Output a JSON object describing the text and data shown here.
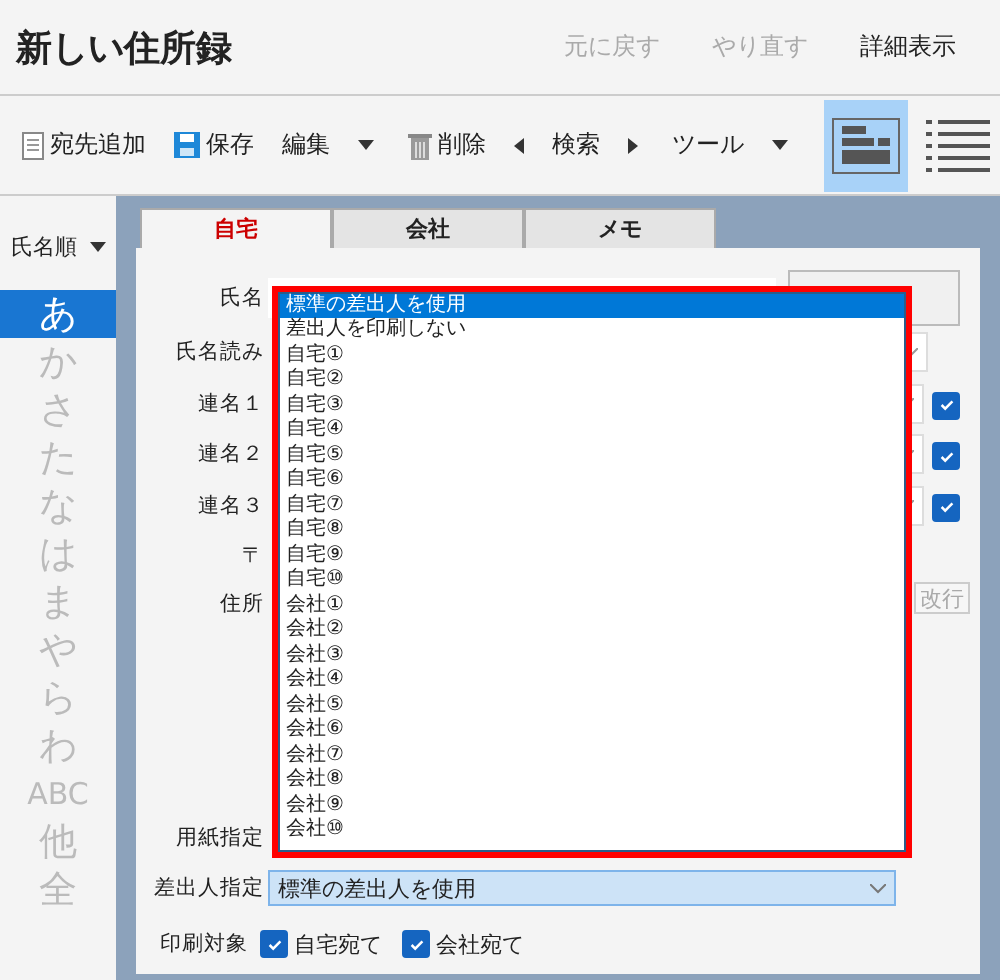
{
  "window": {
    "title": "新しい住所録"
  },
  "header_actions": [
    {
      "label": "元に戻す",
      "disabled": true
    },
    {
      "label": "やり直す",
      "disabled": true
    },
    {
      "label": "詳細表示",
      "disabled": false
    }
  ],
  "toolbar": [
    {
      "kind": "add",
      "label": "宛先追加"
    },
    {
      "kind": "save",
      "label": "保存"
    },
    {
      "kind": "menu",
      "label": "編集"
    },
    {
      "kind": "delete",
      "label": "削除"
    },
    {
      "kind": "nav",
      "label": "検索"
    },
    {
      "kind": "menu",
      "label": "ツール"
    }
  ],
  "view_toggle": [
    {
      "selected": true
    },
    {
      "selected": false
    }
  ],
  "sidebar": {
    "sort": "氏名順",
    "index": [
      {
        "label": "あ",
        "selected": true
      },
      {
        "label": "か",
        "selected": false
      },
      {
        "label": "さ",
        "selected": false
      },
      {
        "label": "た",
        "selected": false
      },
      {
        "label": "な",
        "selected": false
      },
      {
        "label": "は",
        "selected": false
      },
      {
        "label": "ま",
        "selected": false
      },
      {
        "label": "や",
        "selected": false
      },
      {
        "label": "ら",
        "selected": false
      },
      {
        "label": "わ",
        "selected": false
      },
      {
        "label": "ABC",
        "selected": false
      },
      {
        "label": "他",
        "selected": false
      },
      {
        "label": "全",
        "selected": false
      }
    ]
  },
  "tabs": [
    {
      "label": "自宅",
      "selected": true
    },
    {
      "label": "会社",
      "selected": false
    },
    {
      "label": "メモ",
      "selected": false
    }
  ],
  "form": {
    "rows": [
      {
        "label": "氏名",
        "kind": "name"
      },
      {
        "label": "氏名読み",
        "kind": "combo"
      },
      {
        "label": "連名１",
        "kind": "combo_check",
        "checked": true
      },
      {
        "label": "連名２",
        "kind": "combo_check",
        "checked": true
      },
      {
        "label": "連名３",
        "kind": "combo_check",
        "checked": true
      },
      {
        "label": "〒",
        "kind": "blank"
      },
      {
        "label": "住所",
        "kind": "address",
        "button": {
          "label": "改行",
          "disabled": true
        }
      },
      {
        "label": "用紙指定",
        "kind": "blank"
      },
      {
        "label": "差出人指定",
        "kind": "select",
        "value": "標準の差出人を使用"
      }
    ],
    "print_target": {
      "label": "印刷対象",
      "options": [
        {
          "label": "自宅宛て",
          "checked": true
        },
        {
          "label": "会社宛て",
          "checked": true
        }
      ]
    }
  },
  "dropdown": {
    "options": [
      {
        "label": "標準の差出人を使用",
        "selected": true
      },
      {
        "label": "差出人を印刷しない",
        "selected": false
      },
      {
        "label": "自宅①",
        "selected": false
      },
      {
        "label": "自宅②",
        "selected": false
      },
      {
        "label": "自宅③",
        "selected": false
      },
      {
        "label": "自宅④",
        "selected": false
      },
      {
        "label": "自宅⑤",
        "selected": false
      },
      {
        "label": "自宅⑥",
        "selected": false
      },
      {
        "label": "自宅⑦",
        "selected": false
      },
      {
        "label": "自宅⑧",
        "selected": false
      },
      {
        "label": "自宅⑨",
        "selected": false
      },
      {
        "label": "自宅⑩",
        "selected": false
      },
      {
        "label": "会社①",
        "selected": false
      },
      {
        "label": "会社②",
        "selected": false
      },
      {
        "label": "会社③",
        "selected": false
      },
      {
        "label": "会社④",
        "selected": false
      },
      {
        "label": "会社⑤",
        "selected": false
      },
      {
        "label": "会社⑥",
        "selected": false
      },
      {
        "label": "会社⑦",
        "selected": false
      },
      {
        "label": "会社⑧",
        "selected": false
      },
      {
        "label": "会社⑨",
        "selected": false
      },
      {
        "label": "会社⑩",
        "selected": false
      }
    ]
  }
}
